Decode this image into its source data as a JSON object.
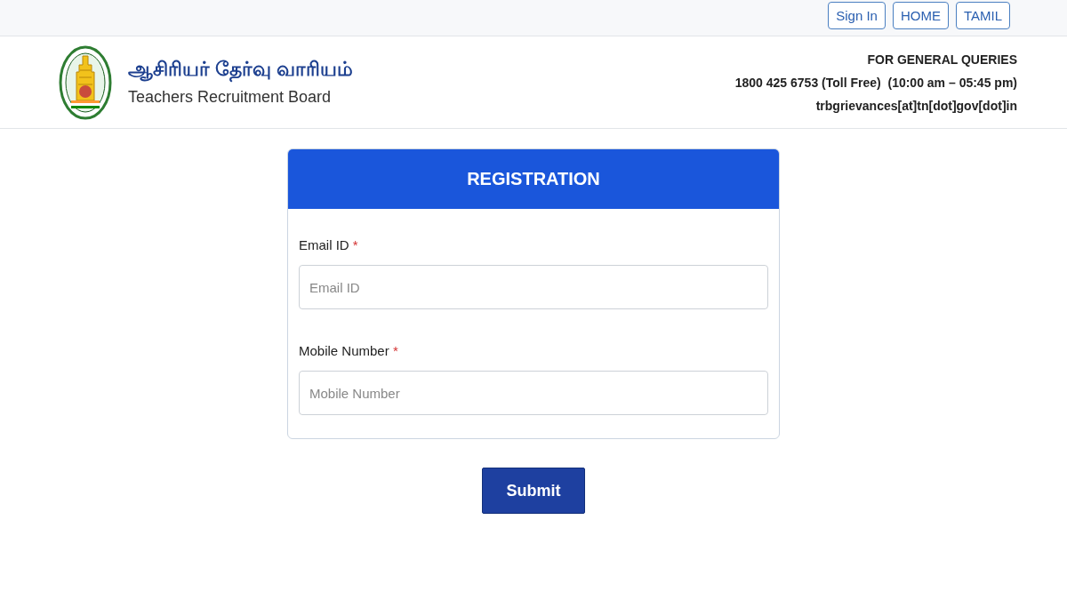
{
  "top_nav": [
    {
      "label": "Sign In"
    },
    {
      "label": "HOME"
    },
    {
      "label": "TAMIL"
    }
  ],
  "header": {
    "title_tamil": "ஆசிரியர் தேர்வு வாரியம்",
    "title_english": "Teachers Recruitment Board",
    "queries_heading": "FOR GENERAL QUERIES",
    "phone": "1800 425 6753 (Toll Free)  (10:00 am – 05:45 pm)",
    "email": "trbgrievances[at]tn[dot]gov[dot]in"
  },
  "form": {
    "title": "REGISTRATION",
    "fields": [
      {
        "label": "Email ID",
        "required_mark": "*",
        "placeholder": "Email ID"
      },
      {
        "label": "Mobile Number",
        "required_mark": "*",
        "placeholder": "Mobile Number"
      }
    ],
    "submit": "Submit"
  }
}
